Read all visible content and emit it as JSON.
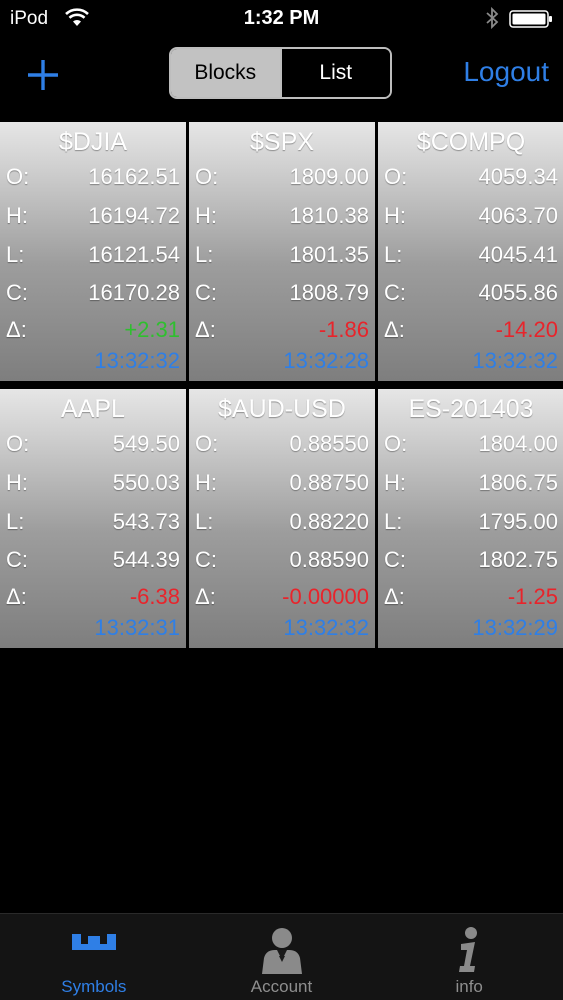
{
  "status": {
    "carrier": "iPod",
    "time": "1:32 PM"
  },
  "nav": {
    "segments": [
      {
        "label": "Blocks",
        "selected": true
      },
      {
        "label": "List",
        "selected": false
      }
    ],
    "logout_label": "Logout"
  },
  "labels": {
    "open": "O:",
    "high": "H:",
    "low": "L:",
    "close": "C:",
    "change": "Δ:"
  },
  "blocks": [
    {
      "symbol": "$DJIA",
      "open": "16162.51",
      "high": "16194.72",
      "low": "16121.54",
      "close": "16170.28",
      "change": "+2.31",
      "direction": "up",
      "time": "13:32:32"
    },
    {
      "symbol": "$SPX",
      "open": "1809.00",
      "high": "1810.38",
      "low": "1801.35",
      "close": "1808.79",
      "change": "-1.86",
      "direction": "down",
      "time": "13:32:28"
    },
    {
      "symbol": "$COMPQ",
      "open": "4059.34",
      "high": "4063.70",
      "low": "4045.41",
      "close": "4055.86",
      "change": "-14.20",
      "direction": "down",
      "time": "13:32:32"
    },
    {
      "symbol": "AAPL",
      "open": "549.50",
      "high": "550.03",
      "low": "543.73",
      "close": "544.39",
      "change": "-6.38",
      "direction": "down",
      "time": "13:32:31"
    },
    {
      "symbol": "$AUD-USD",
      "open": "0.88550",
      "high": "0.88750",
      "low": "0.88220",
      "close": "0.88590",
      "change": "-0.00000",
      "direction": "down",
      "time": "13:32:32"
    },
    {
      "symbol": "ES-201403",
      "open": "1804.00",
      "high": "1806.75",
      "low": "1795.00",
      "close": "1802.75",
      "change": "-1.25",
      "direction": "down",
      "time": "13:32:29"
    }
  ],
  "tabs": [
    {
      "label": "Symbols",
      "icon": "symbols-icon",
      "active": true
    },
    {
      "label": "Account",
      "icon": "account-icon",
      "active": false
    },
    {
      "label": "info",
      "icon": "info-icon",
      "active": false
    }
  ],
  "colors": {
    "accent": "#2f7fe6",
    "up": "#2fbf2f",
    "down": "#e8242b"
  }
}
